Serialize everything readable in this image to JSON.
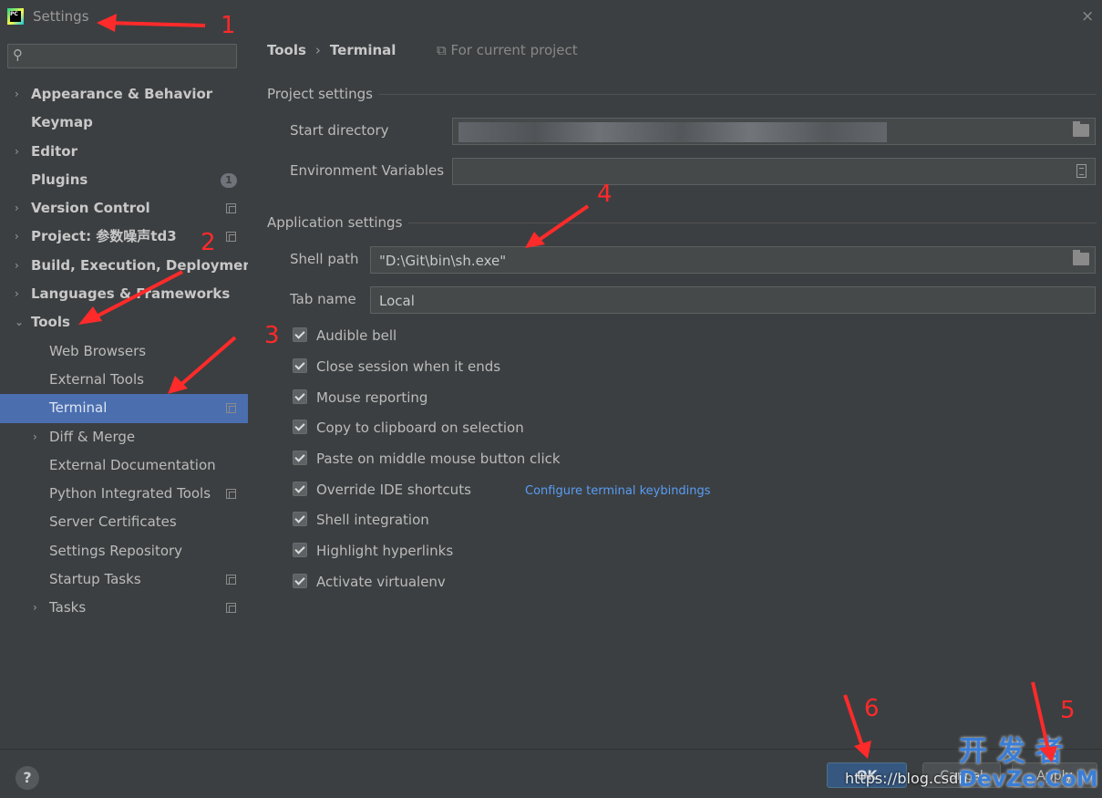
{
  "window": {
    "title": "Settings",
    "close_icon": "×"
  },
  "search": {
    "placeholder": ""
  },
  "sidebar": {
    "items": [
      {
        "label": "Appearance & Behavior",
        "level": 0,
        "expandable": true
      },
      {
        "label": "Keymap",
        "level": 0
      },
      {
        "label": "Editor",
        "level": 0,
        "expandable": true
      },
      {
        "label": "Plugins",
        "level": 0,
        "badge": "1"
      },
      {
        "label": "Version Control",
        "level": 0,
        "expandable": true,
        "project_icon": true
      },
      {
        "label": "Project: 参数噪声td3",
        "level": 0,
        "expandable": true,
        "project_icon": true
      },
      {
        "label": "Build, Execution, Deployment",
        "level": 0,
        "expandable": true
      },
      {
        "label": "Languages & Frameworks",
        "level": 0,
        "expandable": true
      },
      {
        "label": "Tools",
        "level": 0,
        "expanded": true
      },
      {
        "label": "Web Browsers",
        "level": 1
      },
      {
        "label": "External Tools",
        "level": 1
      },
      {
        "label": "Terminal",
        "level": 1,
        "selected": true,
        "project_icon": true
      },
      {
        "label": "Diff & Merge",
        "level": 1,
        "expandable": true
      },
      {
        "label": "External Documentation",
        "level": 1
      },
      {
        "label": "Python Integrated Tools",
        "level": 1,
        "project_icon": true
      },
      {
        "label": "Server Certificates",
        "level": 1
      },
      {
        "label": "Settings Repository",
        "level": 1
      },
      {
        "label": "Startup Tasks",
        "level": 1,
        "project_icon": true
      },
      {
        "label": "Tasks",
        "level": 1,
        "expandable": true,
        "project_icon": true
      }
    ]
  },
  "breadcrumb": {
    "root": "Tools",
    "separator": "›",
    "current": "Terminal",
    "scope": "For current project"
  },
  "project_settings": {
    "heading": "Project settings",
    "start_directory_label": "Start directory",
    "start_directory_value": "",
    "env_vars_label": "Environment Variables",
    "env_vars_value": ""
  },
  "app_settings": {
    "heading": "Application settings",
    "shell_path_label": "Shell path",
    "shell_path_value": "\"D:\\Git\\bin\\sh.exe\"",
    "tab_name_label": "Tab name",
    "tab_name_value": "Local"
  },
  "checkboxes": [
    {
      "label": "Audible bell",
      "checked": true
    },
    {
      "label": "Close session when it ends",
      "checked": true
    },
    {
      "label": "Mouse reporting",
      "checked": true
    },
    {
      "label": "Copy to clipboard on selection",
      "checked": true
    },
    {
      "label": "Paste on middle mouse button click",
      "checked": true
    },
    {
      "label": "Override IDE shortcuts",
      "checked": true,
      "link": "Configure terminal keybindings"
    },
    {
      "label": "Shell integration",
      "checked": true
    },
    {
      "label": "Highlight hyperlinks",
      "checked": true
    },
    {
      "label": "Activate virtualenv",
      "checked": true
    }
  ],
  "footer": {
    "help_label": "?",
    "ok_label": "OK",
    "cancel_label": "Cancel",
    "apply_label": "Apply",
    "watermark_url": "https://blog.csdn.n",
    "watermark_brand_top": "开 发 者",
    "watermark_brand_bottom": "DevZe.CoM"
  },
  "annotations": [
    "1",
    "2",
    "3",
    "4",
    "5",
    "6"
  ],
  "colors": {
    "accent": "#4b6eaf",
    "ok_button": "#365880",
    "link": "#589df6",
    "annotation": "#ff2a2a"
  }
}
